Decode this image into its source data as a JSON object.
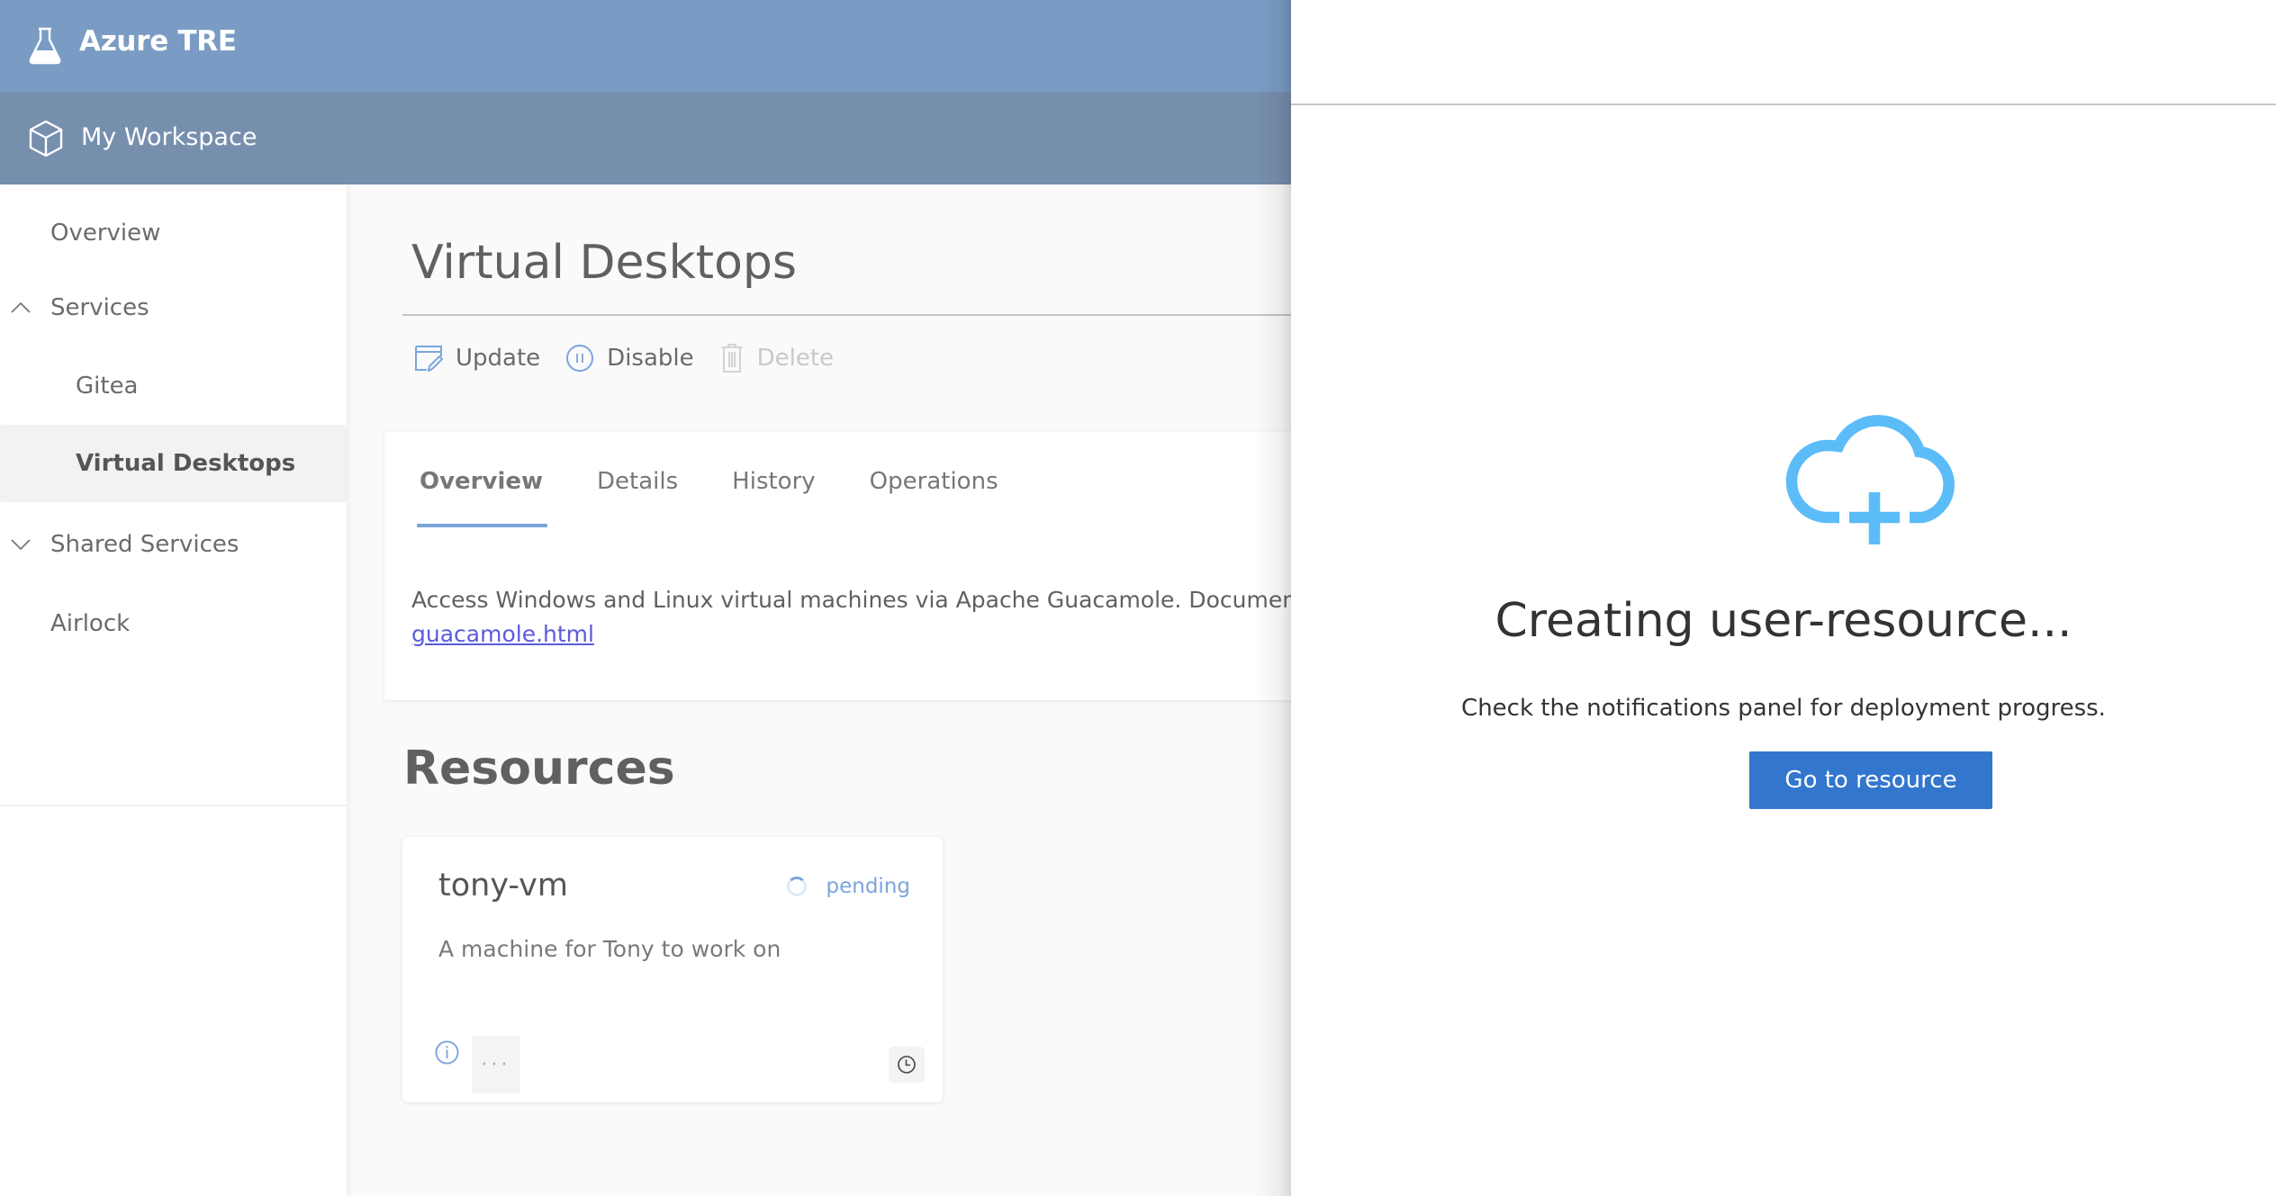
{
  "app": {
    "title": "Azure TRE",
    "icon": "flask-icon"
  },
  "workspace_bar": {
    "label": "My Workspace",
    "icon": "cube-icon"
  },
  "sidebar": {
    "items": [
      {
        "label": "Overview",
        "level": 0,
        "selected": false
      },
      {
        "label": "Services",
        "level": 0,
        "expanded": true,
        "chevron": "chevron-up"
      },
      {
        "label": "Gitea",
        "level": 1,
        "selected": false
      },
      {
        "label": "Virtual Desktops",
        "level": 1,
        "selected": true
      },
      {
        "label": "Shared Services",
        "level": 0,
        "expanded": false,
        "chevron": "chevron-down"
      },
      {
        "label": "Airlock",
        "level": 0,
        "selected": false
      }
    ]
  },
  "main": {
    "title": "Virtual Desktops",
    "actions": [
      {
        "label": "Update",
        "icon": "edit-icon",
        "enabled": true
      },
      {
        "label": "Disable",
        "icon": "pause-circle-icon",
        "enabled": true
      },
      {
        "label": "Delete",
        "icon": "trash-icon",
        "enabled": false
      }
    ],
    "tabs": [
      {
        "label": "Overview",
        "active": true
      },
      {
        "label": "Details",
        "active": false
      },
      {
        "label": "History",
        "active": false
      },
      {
        "label": "Operations",
        "active": false
      }
    ],
    "overview": {
      "description": "Access Windows and Linux virtual machines via Apache Guacamole. Documenta",
      "link_text": "guacamole.html"
    },
    "resources_title": "Resources",
    "resources": [
      {
        "name": "tony-vm",
        "status": "pending",
        "description": "A machine for Tony to work on",
        "more_label": "···"
      }
    ]
  },
  "panel": {
    "icon": "cloud-add-icon",
    "heading": "Creating user-resource...",
    "subtext": "Check the notifications panel for deployment progress.",
    "button_label": "Go to resource"
  },
  "colors": {
    "topbar": "#7a9cc4",
    "workspace_bar": "#768fad",
    "accent": "#3376cd",
    "cloud_icon": "#5bbcf8",
    "tab_underline": "#7ba5dc",
    "link": "#5b5bdc"
  }
}
